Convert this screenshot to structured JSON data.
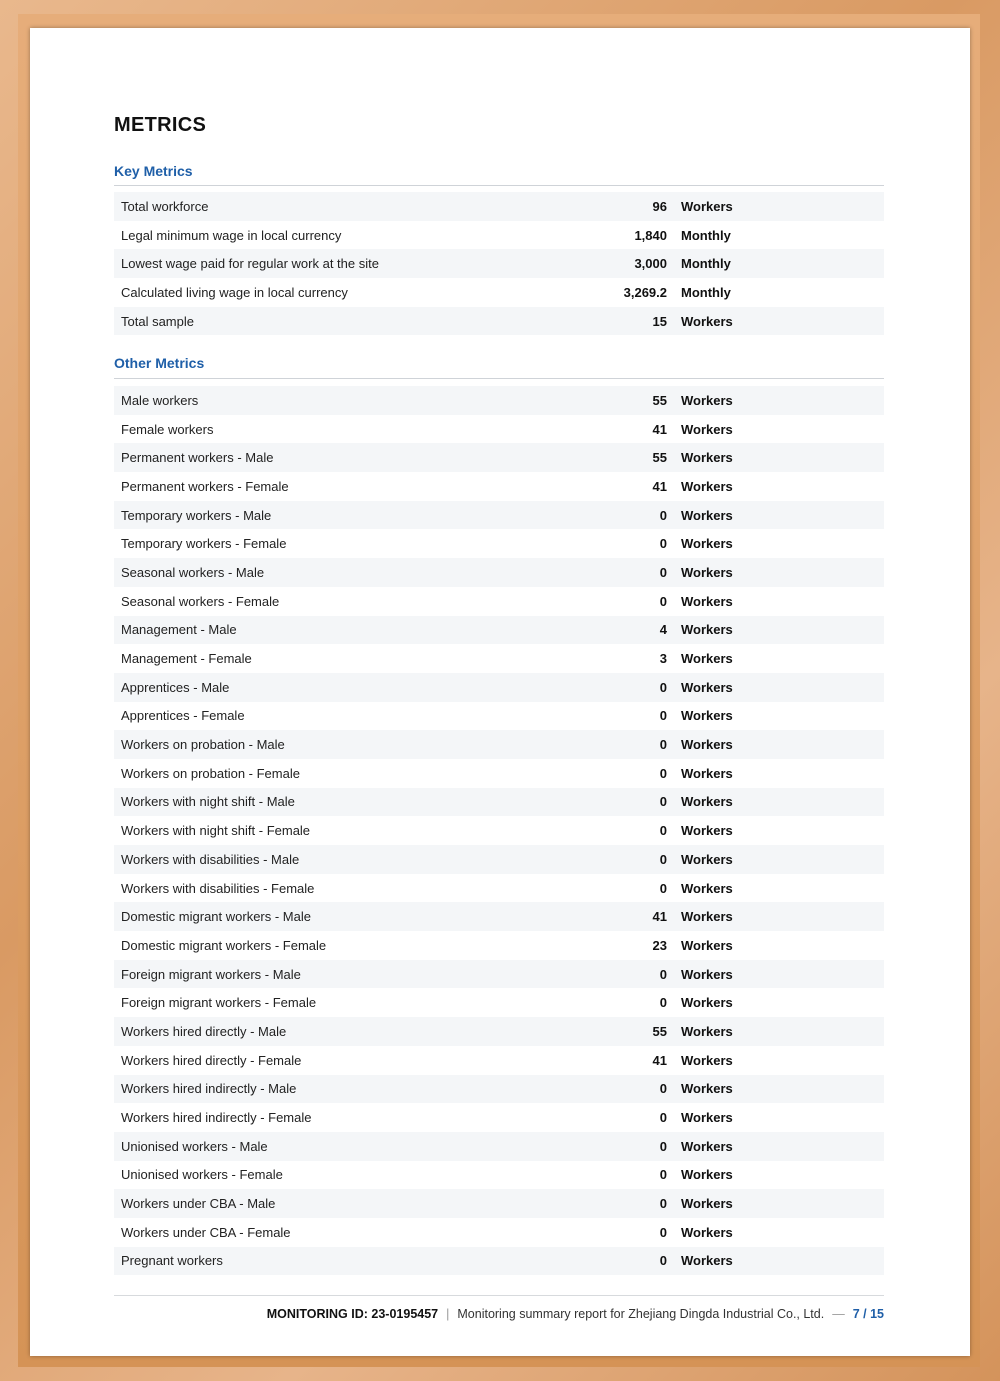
{
  "title": "METRICS",
  "key_metrics": {
    "heading": "Key Metrics",
    "rows": [
      {
        "label": "Total workforce",
        "value": "96",
        "unit": "Workers"
      },
      {
        "label": "Legal minimum wage in local currency",
        "value": "1,840",
        "unit": "Monthly"
      },
      {
        "label": "Lowest wage paid for regular work at the site",
        "value": "3,000",
        "unit": "Monthly"
      },
      {
        "label": "Calculated living wage in local currency",
        "value": "3,269.2",
        "unit": "Monthly"
      },
      {
        "label": "Total sample",
        "value": "15",
        "unit": "Workers"
      }
    ]
  },
  "other_metrics": {
    "heading": "Other Metrics",
    "rows": [
      {
        "label": "Male workers",
        "value": "55",
        "unit": "Workers"
      },
      {
        "label": "Female workers",
        "value": "41",
        "unit": "Workers"
      },
      {
        "label": "Permanent workers - Male",
        "value": "55",
        "unit": "Workers"
      },
      {
        "label": "Permanent workers - Female",
        "value": "41",
        "unit": "Workers"
      },
      {
        "label": "Temporary workers - Male",
        "value": "0",
        "unit": "Workers"
      },
      {
        "label": "Temporary workers - Female",
        "value": "0",
        "unit": "Workers"
      },
      {
        "label": "Seasonal workers - Male",
        "value": "0",
        "unit": "Workers"
      },
      {
        "label": "Seasonal workers - Female",
        "value": "0",
        "unit": "Workers"
      },
      {
        "label": "Management - Male",
        "value": "4",
        "unit": "Workers"
      },
      {
        "label": "Management - Female",
        "value": "3",
        "unit": "Workers"
      },
      {
        "label": "Apprentices - Male",
        "value": "0",
        "unit": "Workers"
      },
      {
        "label": "Apprentices - Female",
        "value": "0",
        "unit": "Workers"
      },
      {
        "label": "Workers on probation - Male",
        "value": "0",
        "unit": "Workers"
      },
      {
        "label": "Workers on probation - Female",
        "value": "0",
        "unit": "Workers"
      },
      {
        "label": "Workers with night shift - Male",
        "value": "0",
        "unit": "Workers"
      },
      {
        "label": "Workers with night shift - Female",
        "value": "0",
        "unit": "Workers"
      },
      {
        "label": "Workers with disabilities - Male",
        "value": "0",
        "unit": "Workers"
      },
      {
        "label": "Workers with disabilities - Female",
        "value": "0",
        "unit": "Workers"
      },
      {
        "label": "Domestic migrant workers - Male",
        "value": "41",
        "unit": "Workers"
      },
      {
        "label": "Domestic migrant workers - Female",
        "value": "23",
        "unit": "Workers"
      },
      {
        "label": "Foreign migrant workers - Male",
        "value": "0",
        "unit": "Workers"
      },
      {
        "label": "Foreign migrant workers - Female",
        "value": "0",
        "unit": "Workers"
      },
      {
        "label": "Workers hired directly - Male",
        "value": "55",
        "unit": "Workers"
      },
      {
        "label": "Workers hired directly - Female",
        "value": "41",
        "unit": "Workers"
      },
      {
        "label": "Workers hired indirectly - Male",
        "value": "0",
        "unit": "Workers"
      },
      {
        "label": "Workers hired indirectly - Female",
        "value": "0",
        "unit": "Workers"
      },
      {
        "label": "Unionised workers - Male",
        "value": "0",
        "unit": "Workers"
      },
      {
        "label": "Unionised workers - Female",
        "value": "0",
        "unit": "Workers"
      },
      {
        "label": "Workers under CBA - Male",
        "value": "0",
        "unit": "Workers"
      },
      {
        "label": "Workers under CBA - Female",
        "value": "0",
        "unit": "Workers"
      },
      {
        "label": "Pregnant workers",
        "value": "0",
        "unit": "Workers"
      }
    ]
  },
  "footer": {
    "monitoring_id": "MONITORING ID: 23-0195457",
    "separator": "|",
    "report_title": "Monitoring summary report for Zhejiang Dingda Industrial Co., Ltd.",
    "dash": "—",
    "page": "7 / 15"
  }
}
